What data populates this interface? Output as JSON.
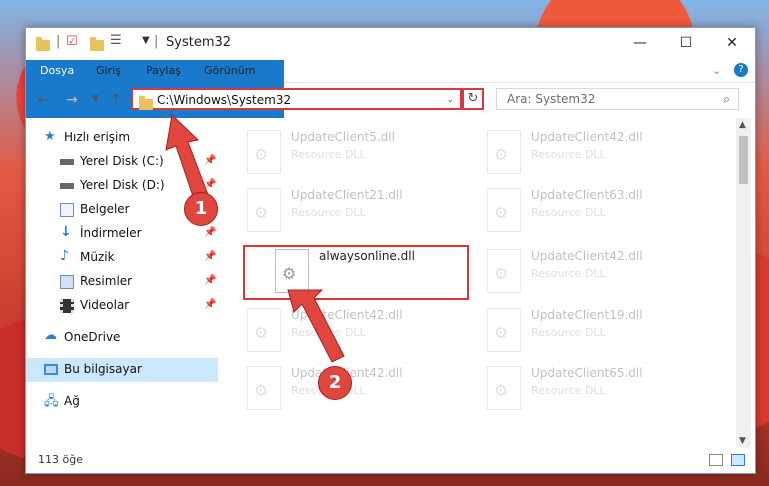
{
  "window": {
    "title": "System32",
    "controls": {
      "minimize": "—",
      "maximize": "☐",
      "close": "✕"
    }
  },
  "ribbon": {
    "tabs": [
      "Dosya",
      "Giriş",
      "Paylaş",
      "Görünüm"
    ]
  },
  "address": {
    "path": "C:\\Windows\\System32",
    "search_placeholder": "Ara: System32"
  },
  "sidebar": {
    "quick_access": "Hızlı erişim",
    "items": [
      {
        "label": "Yerel Disk (C:)",
        "icon": "drive-icon"
      },
      {
        "label": "Yerel Disk (D:)",
        "icon": "drive-icon"
      },
      {
        "label": "Belgeler",
        "icon": "documents-icon"
      },
      {
        "label": "İndirmeler",
        "icon": "downloads-icon"
      },
      {
        "label": "Müzik",
        "icon": "music-icon"
      },
      {
        "label": "Resimler",
        "icon": "pictures-icon"
      },
      {
        "label": "Videolar",
        "icon": "videos-icon"
      }
    ],
    "onedrive": "OneDrive",
    "this_pc": "Bu bilgisayar",
    "network": "Ağ"
  },
  "files": {
    "left": [
      {
        "name": "UpdateClient5.dll",
        "desc": "Resource DLL"
      },
      {
        "name": "UpdateClient21.dll",
        "desc": "Resource DLL"
      },
      {
        "name": "alwaysonline.dll",
        "desc": ""
      },
      {
        "name": "UpdateClient42.dll",
        "desc": "Resource DLL"
      },
      {
        "name": "UpdateClient42.dll",
        "desc": "Resource DLL"
      }
    ],
    "right": [
      {
        "name": "UpdateClient42.dll",
        "desc": "Resource DLL"
      },
      {
        "name": "UpdateClient63.dll",
        "desc": "Resource DLL"
      },
      {
        "name": "UpdateClient42.dll",
        "desc": "Resource DLL"
      },
      {
        "name": "UpdateClient19.dll",
        "desc": "Resource DLL"
      },
      {
        "name": "UpdateClient65.dll",
        "desc": "Resource DLL"
      }
    ]
  },
  "status": {
    "count": "113 öğe"
  },
  "annotations": {
    "step1": "1",
    "step2": "2"
  },
  "colors": {
    "accent": "#1979ca",
    "highlight": "#d9373a"
  }
}
